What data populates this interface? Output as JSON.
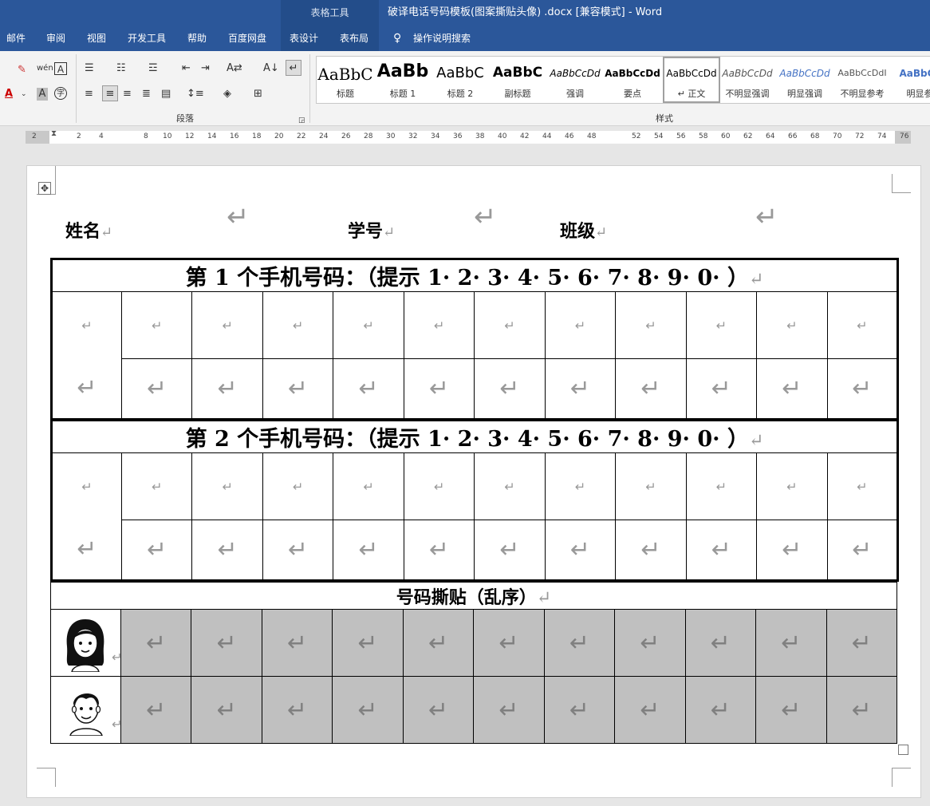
{
  "window": {
    "context_group": "表格工具",
    "doc_title": "破译电话号码模板(图案撕贴头像) .docx [兼容模式]  -  Word"
  },
  "tabs": [
    "邮件",
    "审阅",
    "视图",
    "开发工具",
    "帮助",
    "百度网盘",
    "表设计",
    "表布局"
  ],
  "search": {
    "label": "操作说明搜索"
  },
  "ribbon": {
    "paragraph_label": "段落",
    "styles_label": "样式",
    "styles": [
      {
        "sample": "AaBbC",
        "name": "标题"
      },
      {
        "sample": "AaBb",
        "name": "标题 1"
      },
      {
        "sample": "AaBbC",
        "name": "标题 2"
      },
      {
        "sample": "AaBbC",
        "name": "副标题"
      },
      {
        "sample": "AaBbCcDd",
        "name": "强调"
      },
      {
        "sample": "AaBbCcDd",
        "name": "要点"
      },
      {
        "sample": "AaBbCcDd",
        "name": "↵ 正文"
      },
      {
        "sample": "AaBbCcDd",
        "name": "不明显强调"
      },
      {
        "sample": "AaBbCcDd",
        "name": "明显强调"
      },
      {
        "sample": "AaBbCcDdI",
        "name": "不明显参考"
      },
      {
        "sample": "AaBbCc",
        "name": "明显参"
      }
    ]
  },
  "ruler": {
    "numbers": [
      "2",
      "2",
      "4",
      "8",
      "10",
      "12",
      "14",
      "16",
      "18",
      "20",
      "22",
      "24",
      "26",
      "28",
      "30",
      "32",
      "34",
      "36",
      "38",
      "40",
      "42",
      "44",
      "46",
      "48",
      "52",
      "54",
      "56",
      "58",
      "60",
      "62",
      "64",
      "66",
      "68",
      "70",
      "72",
      "74",
      "76"
    ]
  },
  "document": {
    "fields": {
      "name_label": "姓名",
      "id_label": "学号",
      "class_label": "班级"
    },
    "table1_title": "第 1 个手机号码：（提示 1· 2· 3· 4· 5· 6· 7· 8· 9· 0· ）",
    "table2_title": "第 2 个手机号码：（提示 1· 2· 3· 4· 5· 6· 7· 8· 9· 0· ）",
    "paste_title": "号码撕贴（乱序）",
    "return_mark": "↵"
  }
}
